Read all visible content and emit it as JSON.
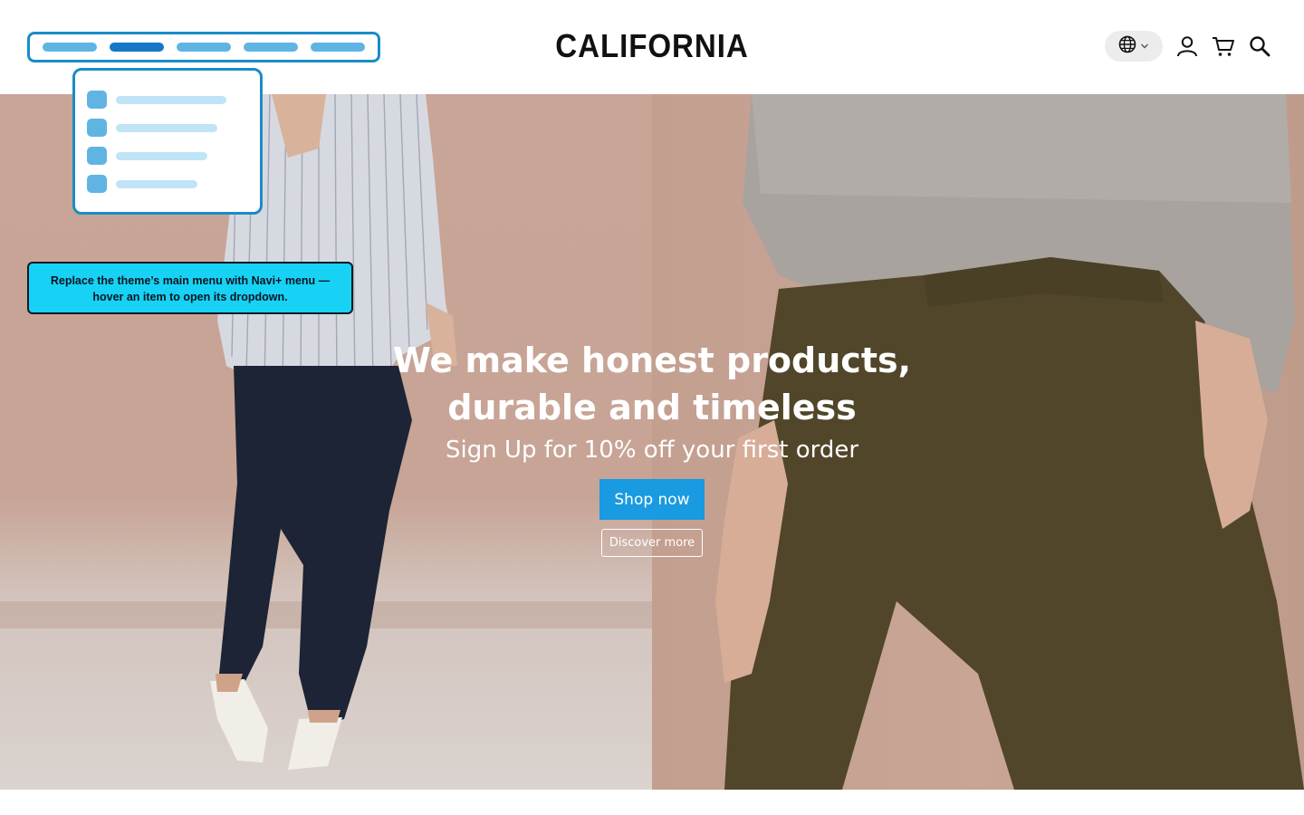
{
  "header": {
    "logo": "CALIFORNIA",
    "menu_items_count_note": "",
    "tooltip": {
      "line1": "Replace the theme’s main menu with Navi+ menu —",
      "line2": "hover an item to open its dropdown."
    }
  },
  "icons": {
    "language": "globe-icon",
    "language_caret": "chevron-down-icon",
    "account": "user-icon",
    "cart": "cart-icon",
    "search": "search-icon"
  },
  "hero": {
    "headline_line1": "We make honest products,",
    "headline_line2": "durable and timeless",
    "subline": "Sign Up for 10% off your first order",
    "primary_cta": "Shop now",
    "secondary_cta": "Discover more"
  },
  "colors": {
    "accent": "#1a9ae0",
    "menu_outline": "#1a8cc8",
    "tooltip_bg": "#17d2f5"
  }
}
